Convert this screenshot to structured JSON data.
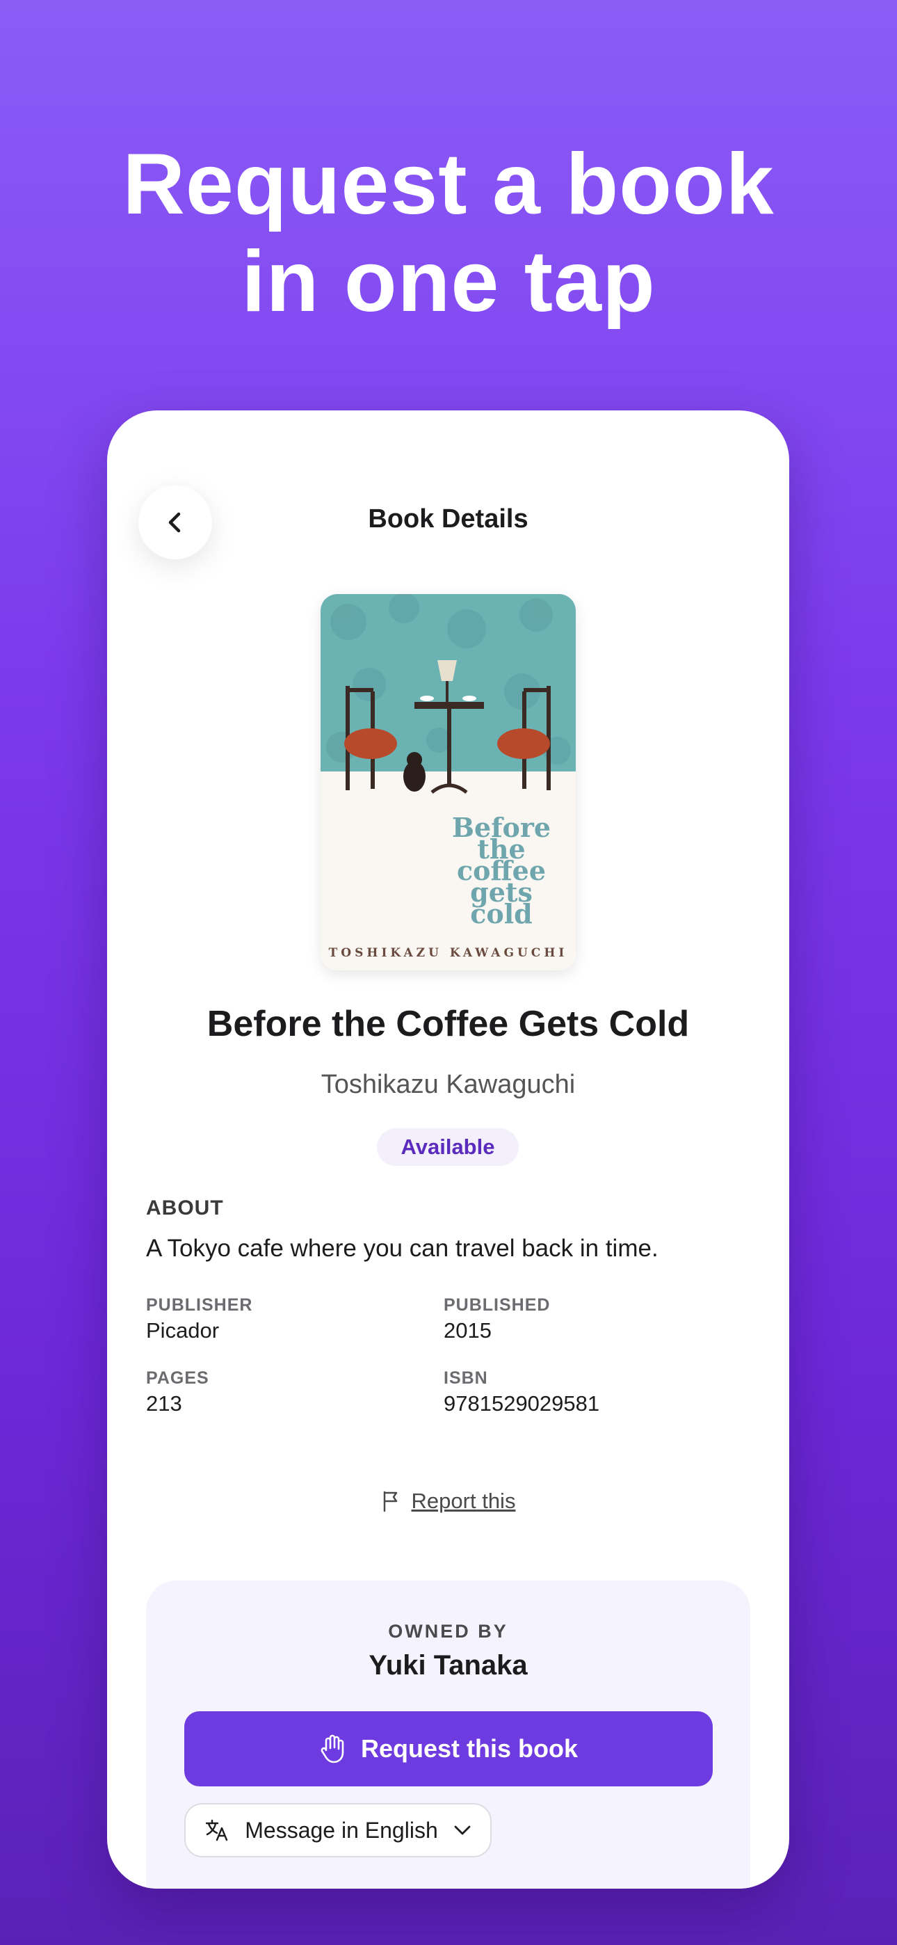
{
  "headline": {
    "line1": "Request a book",
    "line2": "in one tap"
  },
  "nav": {
    "title": "Book Details",
    "back_icon": "chevron-left-icon"
  },
  "cover": {
    "title_text": "Before\nthe\ncoffee\ngets\ncold",
    "author_text": "TOSHIKAZU KAWAGUCHI"
  },
  "book": {
    "title": "Before the Coffee Gets Cold",
    "author": "Toshikazu Kawaguchi",
    "status": "Available"
  },
  "about": {
    "label": "ABOUT",
    "text": "A Tokyo cafe where you can travel back in time."
  },
  "meta": {
    "publisher_label": "PUBLISHER",
    "publisher": "Picador",
    "published_label": "PUBLISHED",
    "published": "2015",
    "pages_label": "PAGES",
    "pages": "213",
    "isbn_label": "ISBN",
    "isbn": "9781529029581"
  },
  "report": {
    "label": "Report this",
    "icon": "flag-icon"
  },
  "owner": {
    "owned_by_label": "OWNED BY",
    "name": "Yuki Tanaka",
    "request_label": "Request this book",
    "request_icon": "hand-icon",
    "language_label": "Message in English",
    "language_icon": "translate-icon"
  },
  "colors": {
    "accent": "#6d3be0",
    "badge_bg": "#f3f0fb",
    "badge_text": "#5b2bbd",
    "card_bg": "#f5f3fd"
  }
}
